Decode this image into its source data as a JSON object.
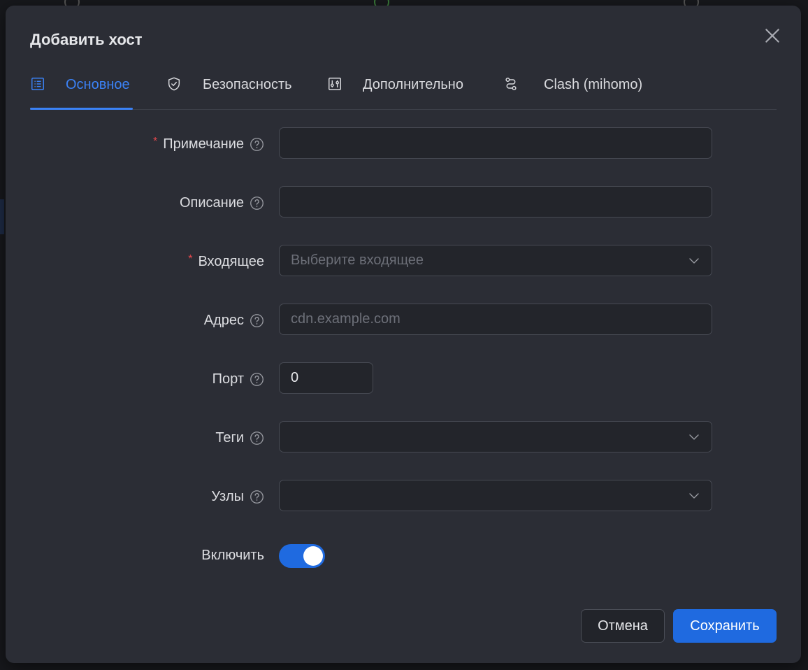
{
  "modal": {
    "title": "Добавить хост"
  },
  "tabs": [
    {
      "label": "Основное",
      "icon": "list-icon",
      "active": true
    },
    {
      "label": "Безопасность",
      "icon": "shield-check-icon",
      "active": false
    },
    {
      "label": "Дополнительно",
      "icon": "sliders-icon",
      "active": false
    },
    {
      "label": "Clash (mihomo)",
      "icon": "route-icon",
      "active": false
    }
  ],
  "form": {
    "remark": {
      "label": "Примечание",
      "required": true,
      "value": ""
    },
    "description": {
      "label": "Описание",
      "value": ""
    },
    "inbound": {
      "label": "Входящее",
      "required": true,
      "placeholder": "Выберите входящее"
    },
    "address": {
      "label": "Адрес",
      "placeholder": "cdn.example.com",
      "value": ""
    },
    "port": {
      "label": "Порт",
      "value": "0"
    },
    "tags": {
      "label": "Теги",
      "value": ""
    },
    "nodes": {
      "label": "Узлы",
      "value": ""
    },
    "enable": {
      "label": "Включить",
      "on": true
    }
  },
  "buttons": {
    "cancel": "Отмена",
    "save": "Сохранить"
  },
  "colors": {
    "accent": "#3b82f6",
    "primary_button": "#1f6ae0",
    "required_mark": "#e5484d"
  }
}
